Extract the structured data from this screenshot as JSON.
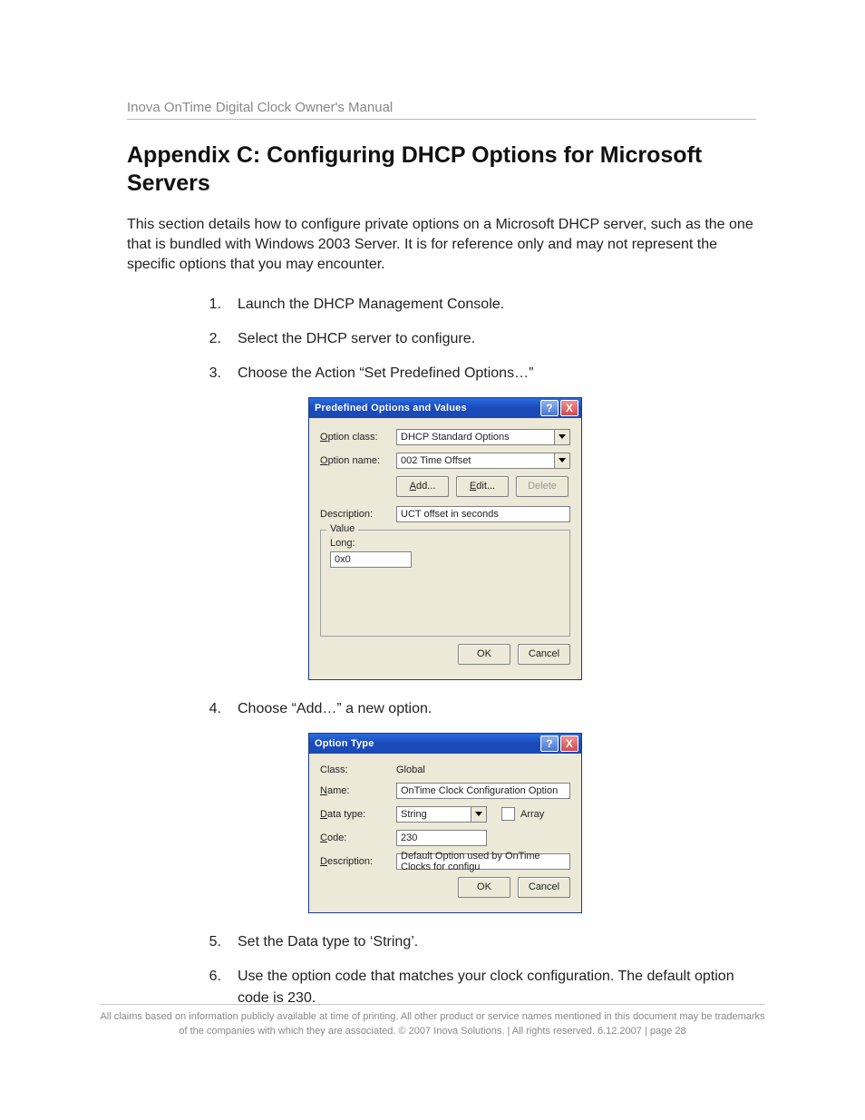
{
  "header": "Inova OnTime Digital Clock Owner's Manual",
  "title": "Appendix C:  Configuring DHCP Options for Microsoft Servers",
  "intro": "This section details how to configure private options on a Microsoft DHCP server, such as the one that is bundled with Windows 2003 Server.  It is for reference only and may not represent the specific options that you may encounter.",
  "steps": {
    "s1": "Launch the DHCP Management Console.",
    "s2": "Select the DHCP server to configure.",
    "s3": "Choose the Action “Set Predefined Options…”",
    "s4": "Choose “Add…” a new option.",
    "s5": "Set the Data type to ‘String’.",
    "s6": "Use the option code that matches your clock configuration.  The default option code is 230."
  },
  "dlg1": {
    "title": "Predefined Options and Values",
    "labels": {
      "class": "Option class:",
      "name": "Option name:",
      "desc": "Description:",
      "value": "Value",
      "long": "Long:"
    },
    "class_value": "DHCP Standard Options",
    "name_value": "002 Time Offset",
    "desc_value": "UCT offset in seconds",
    "long_value": "0x0",
    "btn_add": "Add...",
    "btn_edit": "Edit...",
    "btn_delete": "Delete",
    "btn_ok": "OK",
    "btn_cancel": "Cancel"
  },
  "dlg2": {
    "title": "Option Type",
    "labels": {
      "class": "Class:",
      "name": "Name:",
      "dtype": "Data type:",
      "code": "Code:",
      "desc": "Description:",
      "array": "Array"
    },
    "class_value": "Global",
    "name_value": "OnTime Clock Configuration Option",
    "dtype_value": "String",
    "code_value": "230",
    "desc_value": "Default Option used by OnTime Clocks for configu",
    "btn_ok": "OK",
    "btn_cancel": "Cancel"
  },
  "footer": "All claims based on information publicly available at time of printing. All other product or service names mentioned in this document may be trademarks of the companies with which they are associated. © 2007 Inova Solutions.  |  All rights reserved. 6.12.2007  |  page 28"
}
